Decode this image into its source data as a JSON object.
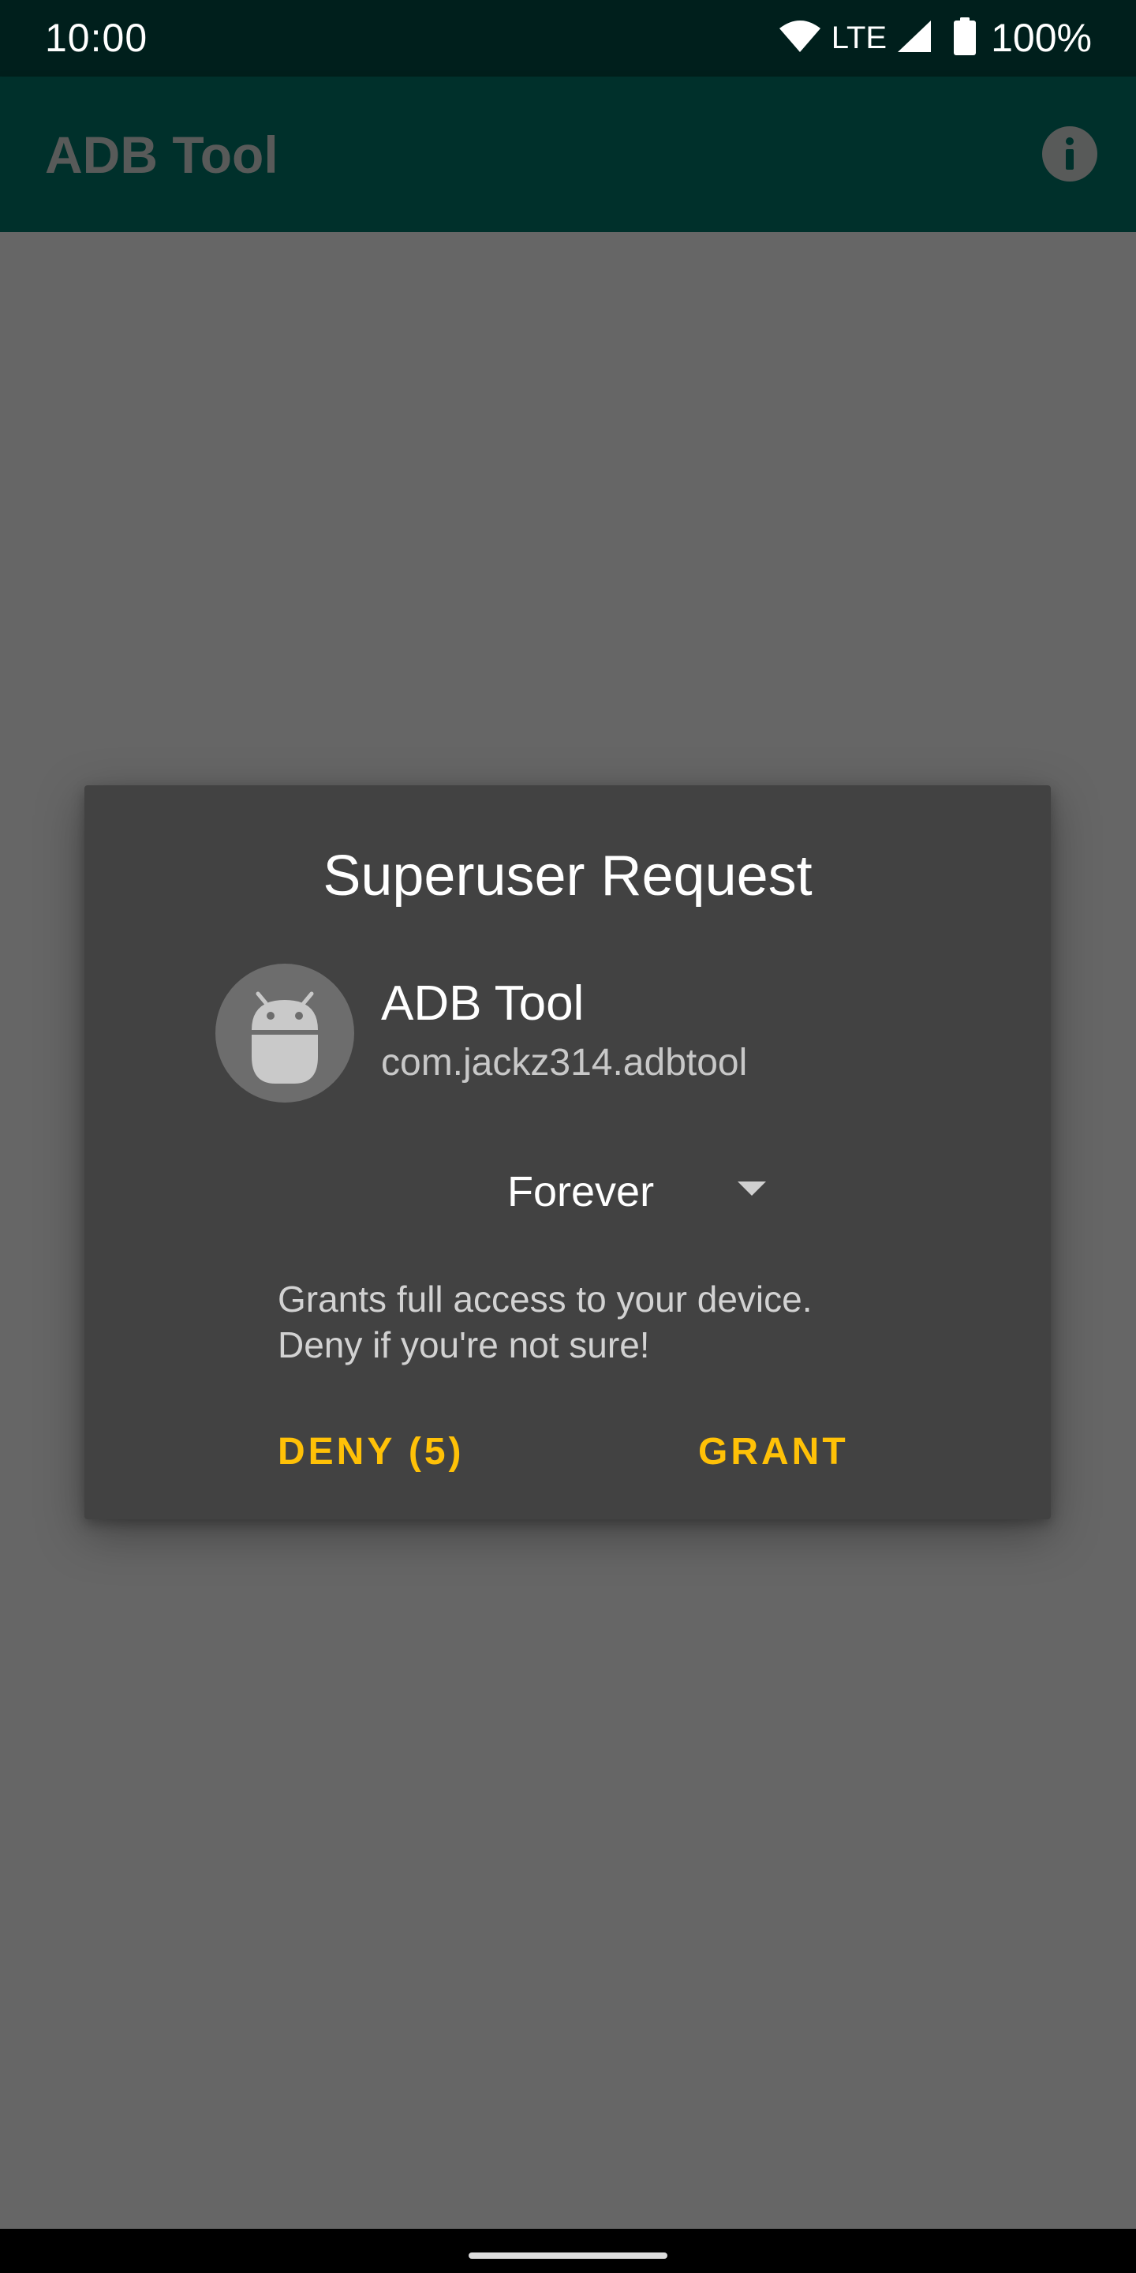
{
  "status_bar": {
    "time": "10:00",
    "network": "LTE",
    "battery": "100%",
    "icons": [
      "wifi-icon",
      "cellular-signal-icon",
      "battery-icon"
    ]
  },
  "app_bar": {
    "title": "ADB Tool",
    "action_icon": "info-icon"
  },
  "dialog": {
    "title": "Superuser Request",
    "app_icon": "android-icon",
    "app_name": "ADB Tool",
    "package_name": "com.jackz314.adbtool",
    "duration": {
      "selected": "Forever",
      "icon": "dropdown-arrow-icon"
    },
    "warning_line1": "Grants full access to your device.",
    "warning_line2": "Deny if you're not sure!",
    "deny_label": "DENY (5)",
    "grant_label": "GRANT"
  },
  "colors": {
    "status_bar_bg": "#001f1c",
    "app_bar_bg": "#00302b",
    "scrim_bg": "#666666",
    "dialog_bg": "#424242",
    "accent": "#ffc107"
  }
}
